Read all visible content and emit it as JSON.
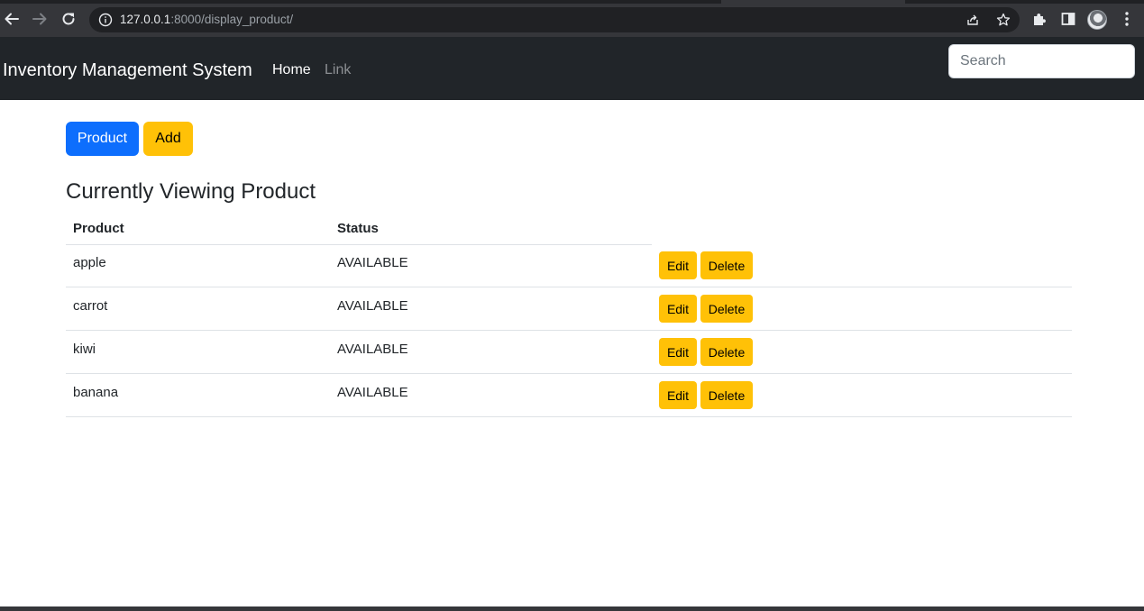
{
  "browser": {
    "url_host": "127.0.0.1",
    "url_path": ":8000/display_product/"
  },
  "navbar": {
    "brand": "Inventory Management System",
    "links": [
      {
        "label": "Home",
        "active": true
      },
      {
        "label": "Link",
        "active": false
      }
    ],
    "search_placeholder": "Search"
  },
  "toolbar": {
    "product_label": "Product",
    "add_label": "Add"
  },
  "main": {
    "heading": "Currently Viewing Product",
    "columns": [
      "Product",
      "Status"
    ],
    "rows": [
      {
        "product": "apple",
        "status": "AVAILABLE"
      },
      {
        "product": "carrot",
        "status": "AVAILABLE"
      },
      {
        "product": "kiwi",
        "status": "AVAILABLE"
      },
      {
        "product": "banana",
        "status": "AVAILABLE"
      }
    ],
    "edit_label": "Edit",
    "delete_label": "Delete"
  },
  "colors": {
    "navbar_bg": "#212529",
    "primary": "#0d6efd",
    "warning": "#ffc107"
  }
}
